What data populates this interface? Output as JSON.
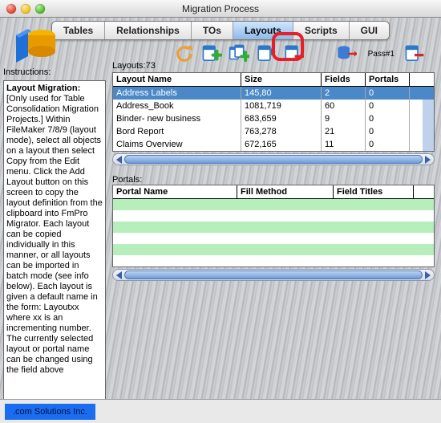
{
  "window": {
    "title": "Migration Process"
  },
  "tabs": {
    "items": [
      {
        "label": "Tables",
        "active": false
      },
      {
        "label": "Relationships",
        "active": false
      },
      {
        "label": "TOs",
        "active": false
      },
      {
        "label": "Layouts",
        "active": true
      },
      {
        "label": "Scripts",
        "active": false
      },
      {
        "label": "GUI",
        "active": false
      }
    ]
  },
  "toolbar": {
    "pass_label": "Pass#1"
  },
  "sidebar": {
    "instructions_heading": "Instructions:",
    "title": "Layout Migration:",
    "body": "[Only used for Table Consolidation Migration Projects.] Within FileMaker 7/8/9 (layout mode), select all objects on a layout then select Copy from the Edit menu. Click the Add Layout button on this screen to copy the layout definition from the clipboard into FmPro Migrator. Each layout can be copied individually in this manner, or all layouts can be imported in batch mode (see info below). Each layout is given a default name in the form: Layoutxx where xx is an incrementing number.  The currently selected layout or portal name can be changed using the field above"
  },
  "layouts": {
    "count_label": "Layouts:",
    "count": "73",
    "columns": {
      "name": "Layout Name",
      "size": "Size",
      "fields": "Fields",
      "portals": "Portals"
    },
    "rows": [
      {
        "name": "Address Labels",
        "size": "145,80",
        "fields": "2",
        "portals": "0",
        "selected": true
      },
      {
        "name": "Address_Book",
        "size": "1081,719",
        "fields": "60",
        "portals": "0",
        "selected": false
      },
      {
        "name": "Binder- new business",
        "size": "683,659",
        "fields": "9",
        "portals": "0",
        "selected": false
      },
      {
        "name": "Bord Report",
        "size": "763,278",
        "fields": "21",
        "portals": "0",
        "selected": false
      },
      {
        "name": "Claims Overview",
        "size": "672,165",
        "fields": "11",
        "portals": "0",
        "selected": false
      }
    ]
  },
  "portals": {
    "label": "Portals:",
    "columns": {
      "name": "Portal Name",
      "fill": "Fill Method",
      "titles": "Field Titles"
    }
  },
  "footer": {
    "brand": ".com Solutions Inc."
  }
}
